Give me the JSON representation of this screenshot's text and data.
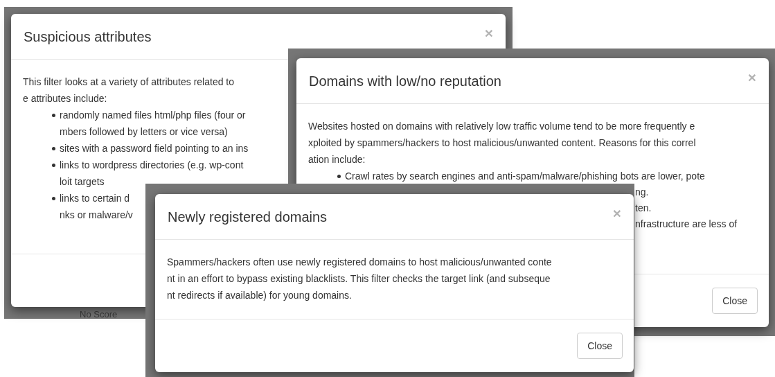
{
  "dialogs": [
    {
      "title": "Suspicious attributes",
      "close_glyph": "×",
      "lines": [
        {
          "kind": "text",
          "text": "This filter looks at a variety of attributes related to"
        },
        {
          "kind": "text",
          "text": "e attributes include:"
        },
        {
          "kind": "bullet",
          "text": "randomly named files html/php files (four or"
        },
        {
          "kind": "continuation",
          "text": "mbers followed by letters or vice versa)"
        },
        {
          "kind": "bullet",
          "text": "sites with a password field pointing to an ins"
        },
        {
          "kind": "bullet",
          "text": "links to wordpress directories (e.g. wp-cont"
        },
        {
          "kind": "continuation",
          "text": "loit targets"
        },
        {
          "kind": "bullet",
          "text": "links to certain d"
        },
        {
          "kind": "continuation",
          "text": "nks or malware/v"
        }
      ],
      "backdrop_texts": [
        "No Score"
      ]
    },
    {
      "title": "Domains with low/no reputation",
      "close_glyph": "×",
      "lines": [
        {
          "kind": "text",
          "text": "Websites hosted on domains with relatively low traffic volume tend to be more frequently e"
        },
        {
          "kind": "text",
          "text": "xploited by spammers/hackers to host malicious/unwanted content. Reasons for this correl"
        },
        {
          "kind": "text",
          "text": "ation include:"
        },
        {
          "kind": "bullet",
          "text": "Crawl rates by search engines and anti-spam/malware/phishing bots are lower, pote"
        },
        {
          "kind": "fragment",
          "text": "ng."
        },
        {
          "kind": "fragment",
          "text": "ten."
        },
        {
          "kind": "fragment",
          "text": "nfrastructure are less of"
        }
      ],
      "button": "Close"
    },
    {
      "title": "Newly registered domains",
      "close_glyph": "×",
      "lines": [
        {
          "kind": "text",
          "text": "Spammers/hackers often use newly registered domains to host malicious/unwanted conte"
        },
        {
          "kind": "text",
          "text": "nt in an effort to bypass existing blacklists. This filter checks the target link (and subseque"
        },
        {
          "kind": "text",
          "text": "nt redirects if available) for young domains."
        }
      ],
      "button": "Close"
    }
  ]
}
